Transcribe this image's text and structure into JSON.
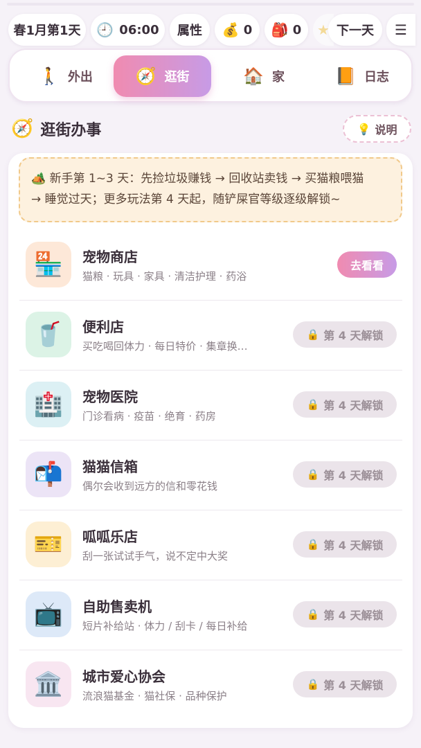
{
  "topbar": {
    "date": "春1月第1天",
    "time": "06:00",
    "time_icon": "clock-icon",
    "attr_label": "属性",
    "money_value": "0",
    "money_icon": "money-bag-icon",
    "bag_value": "0",
    "bag_icon": "backpack-icon",
    "next_day_label": "下一天",
    "menu_icon": "hamburger-menu-icon"
  },
  "nav": {
    "tabs": [
      {
        "label": "外出",
        "icon": "walking-person-icon"
      },
      {
        "label": "逛街",
        "icon": "compass-icon"
      },
      {
        "label": "家",
        "icon": "house-icon"
      },
      {
        "label": "日志",
        "icon": "notebook-icon"
      }
    ],
    "active": "逛街",
    "accent_gradient": [
      "#f08bb0",
      "#c79be6"
    ]
  },
  "section": {
    "title": "逛街办事",
    "icon": "compass-icon",
    "help_label": "说明",
    "help_icon": "lightbulb-icon"
  },
  "tip": {
    "icon": "camping-icon",
    "line1": "新手第 1~3 天：先捡垃圾赚钱 → 回收站卖钱 → 买猫粮喂猫",
    "line2": "→ 睡觉过天；更多玩法第 4 天起，随铲屎官等级逐级解锁~"
  },
  "shops": [
    {
      "name": "宠物商店",
      "desc": "猫粮 · 玩具 · 家具 · 清洁护理 · 药浴",
      "icon": "convenience-store-icon",
      "action": "去看看",
      "locked": false
    },
    {
      "name": "便利店",
      "desc": "买吃喝回体力 · 每日特价 · 集章换…",
      "icon": "cup-with-straw-icon",
      "action": "第 4 天解锁",
      "locked": true
    },
    {
      "name": "宠物医院",
      "desc": "门诊看病 · 疫苗 · 绝育 · 药房",
      "icon": "hospital-icon",
      "action": "第 4 天解锁",
      "locked": true
    },
    {
      "name": "猫猫信箱",
      "desc": "偶尔会收到远方的信和零花钱",
      "icon": "mailbox-icon",
      "action": "第 4 天解锁",
      "locked": true
    },
    {
      "name": "呱呱乐店",
      "desc": "刮一张试试手气，说不定中大奖",
      "icon": "ticket-icon",
      "action": "第 4 天解锁",
      "locked": true
    },
    {
      "name": "自助售卖机",
      "desc": "短片补给站 · 体力 / 刮卡 / 每日补给",
      "icon": "television-icon",
      "action": "第 4 天解锁",
      "locked": true
    },
    {
      "name": "城市爱心协会",
      "desc": "流浪猫基金 · 猫社保 · 品种保护",
      "icon": "classical-building-icon",
      "action": "第 4 天解锁",
      "locked": true
    }
  ]
}
